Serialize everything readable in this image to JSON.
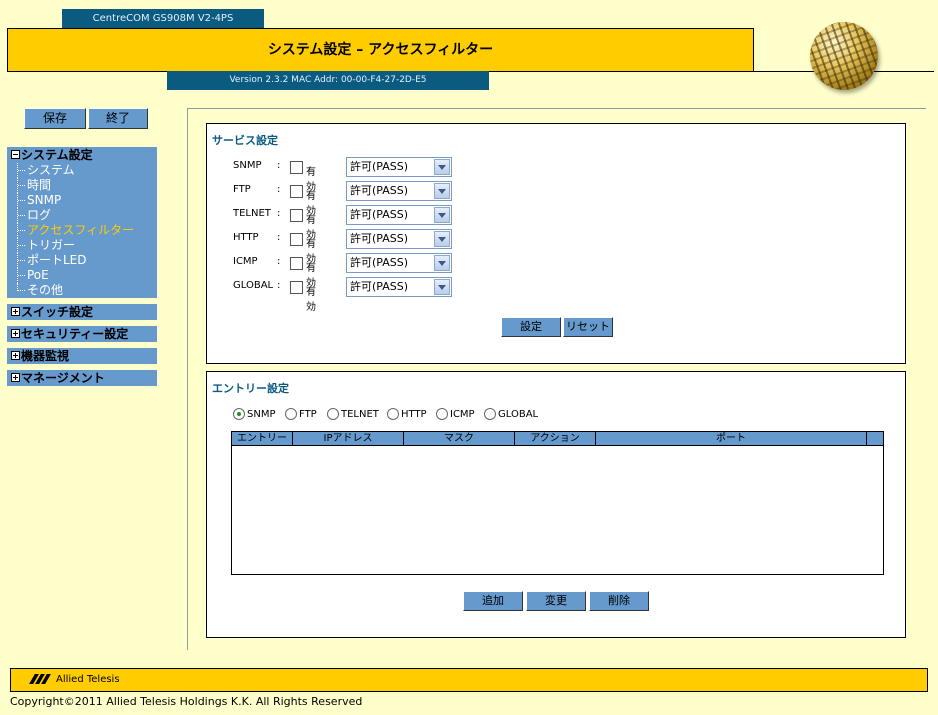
{
  "header": {
    "model": "CentreCOM GS908M V2-4PS",
    "title": "システム設定 – アクセスフィルター",
    "version": "Version 2.3.2 MAC Addr: 00-00-F4-27-2D-E5"
  },
  "side_buttons": {
    "save": "保存",
    "exit": "終了"
  },
  "nav": {
    "system": {
      "label": "システム設定",
      "items": [
        "システム",
        "時間",
        "SNMP",
        "ログ",
        "アクセスフィルター",
        "トリガー",
        "ポートLED",
        "PoE",
        "その他"
      ],
      "active": "アクセスフィルター"
    },
    "groups": [
      "スイッチ設定",
      "セキュリティー設定",
      "機器監視",
      "マネージメント"
    ]
  },
  "service": {
    "title": "サービス設定",
    "enable_label": "有効",
    "rows": [
      {
        "name": "SNMP",
        "sep": ":",
        "action": "許可(PASS)"
      },
      {
        "name": "FTP",
        "sep": ":",
        "action": "許可(PASS)"
      },
      {
        "name": "TELNET",
        "sep": ":",
        "action": "許可(PASS)"
      },
      {
        "name": "HTTP",
        "sep": ":",
        "action": "許可(PASS)"
      },
      {
        "name": "ICMP",
        "sep": ":",
        "action": "許可(PASS)"
      },
      {
        "name": "GLOBAL",
        "sep": ":",
        "action": "許可(PASS)"
      }
    ],
    "set_button": "設定",
    "reset_button": "リセット"
  },
  "entry": {
    "title": "エントリー設定",
    "radios": [
      "SNMP",
      "FTP",
      "TELNET",
      "HTTP",
      "ICMP",
      "GLOBAL"
    ],
    "selected_radio": "SNMP",
    "columns": [
      "エントリー",
      "IPアドレス",
      "マスク",
      "アクション",
      "ポート"
    ],
    "add_button": "追加",
    "change_button": "変更",
    "delete_button": "削除"
  },
  "footer": {
    "brand": "Allied Telesis",
    "copyright": "Copyright©2011 Allied Telesis Holdings K.K. All Rights Reserved"
  },
  "colors": {
    "title_bar": "#FFCC00",
    "nav_bg": "#6699CC",
    "header_tab": "#0B5A80",
    "page_bg": "#FFFFCC",
    "active_nav": "#FFCC00"
  }
}
